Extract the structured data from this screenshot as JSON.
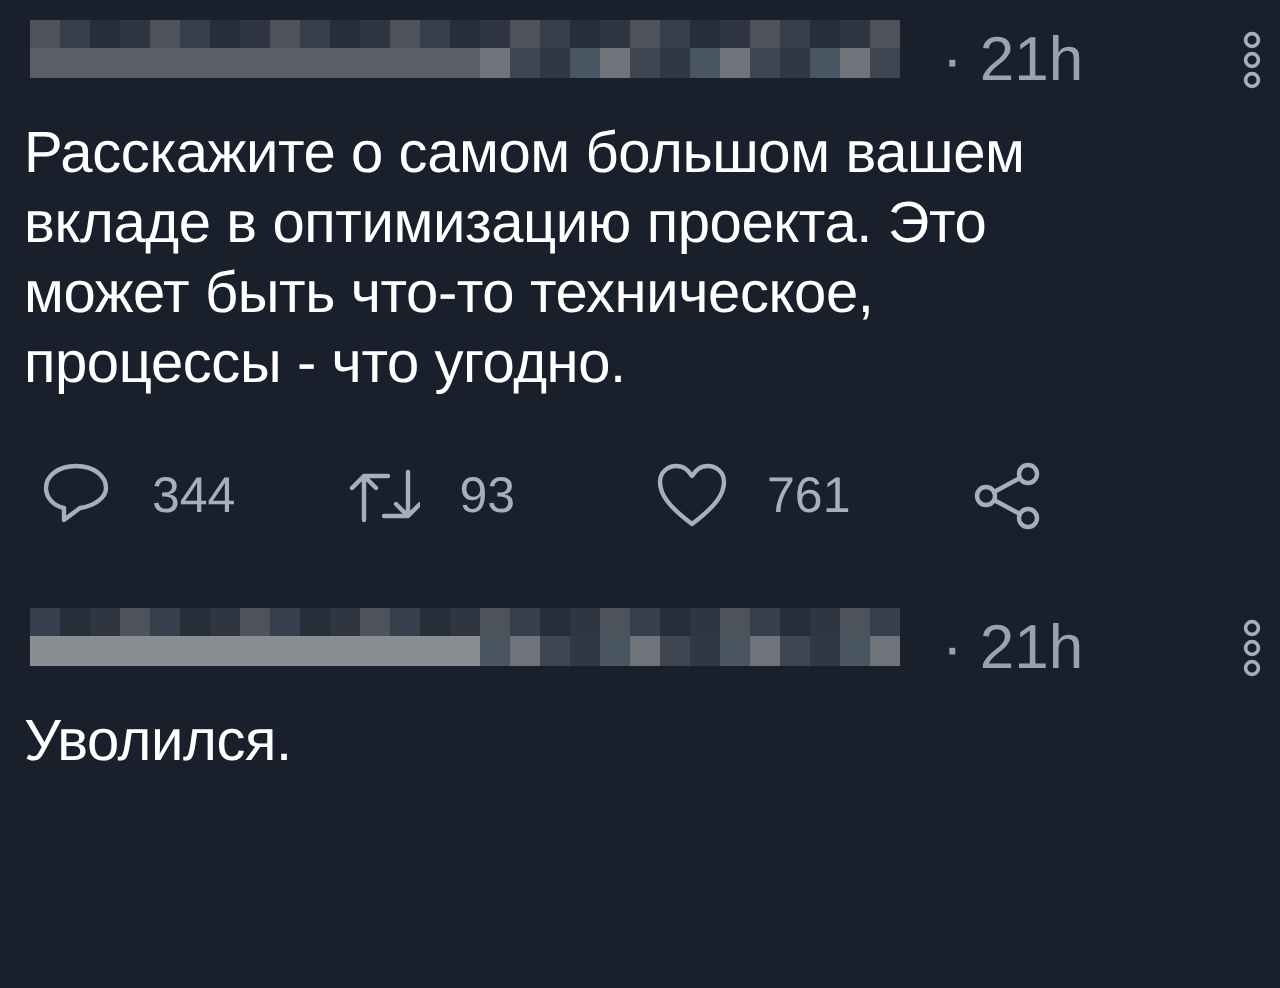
{
  "tweets": [
    {
      "time": "· 21h",
      "text": "Расскажите о самом большом вашем вкладе в оптимизацию проекта. Это может быть что-то техническое, процессы - что угодно.",
      "actions": [
        {
          "kind": "reply",
          "count": "344"
        },
        {
          "kind": "retweet",
          "count": "93"
        },
        {
          "kind": "like",
          "count": "761"
        },
        {
          "kind": "share"
        }
      ]
    },
    {
      "time": "· 21h",
      "text": "Уволился."
    }
  ]
}
